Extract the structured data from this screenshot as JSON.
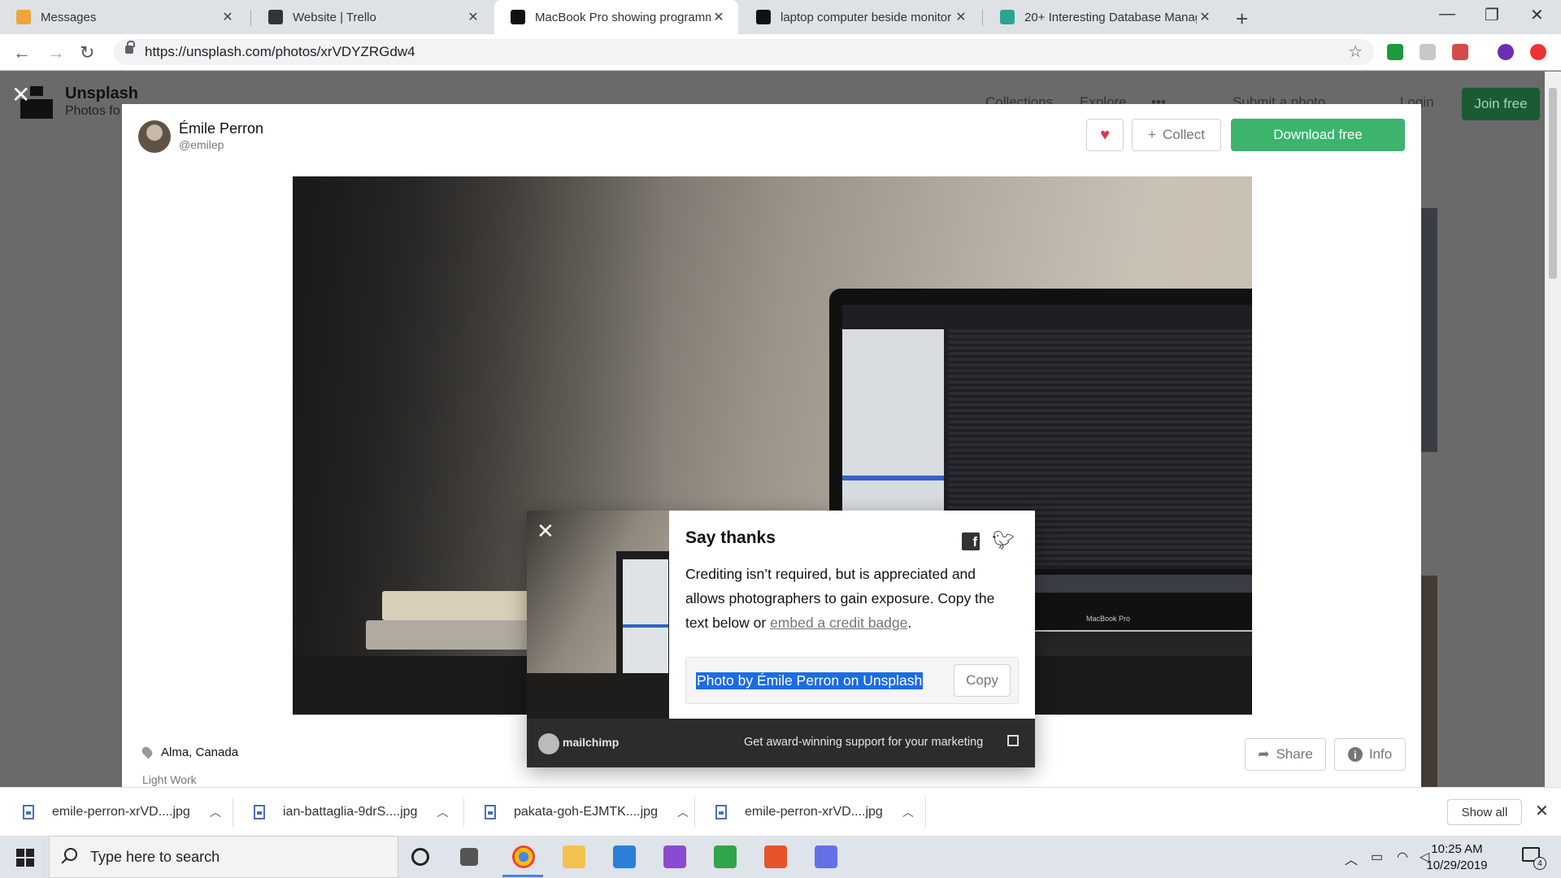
{
  "browser": {
    "tabs": [
      {
        "title": "Messages",
        "favicon_color": "#f3a33c"
      },
      {
        "title": "Website | Trello",
        "favicon_color": "#333333"
      },
      {
        "title": "MacBook Pro showing programm",
        "favicon_color": "#111111",
        "active": true
      },
      {
        "title": "laptop computer beside monitor",
        "favicon_color": "#111111"
      },
      {
        "title": "20+ Interesting Database Manag",
        "favicon_color": "#2ba58e"
      }
    ],
    "new_tab": "+",
    "url": "https://unsplash.com/photos/xrVDYZRGdw4"
  },
  "background_page": {
    "brand": "Unsplash",
    "tagline": "Photos fo",
    "nav": [
      "Collections",
      "Explore",
      "•••",
      "Submit a photo",
      "Login"
    ],
    "join": "Join free"
  },
  "modal": {
    "author_name": "Émile Perron",
    "author_username": "@emilep",
    "collect_label": "Collect",
    "download_label": "Download free",
    "location": "Alma, Canada",
    "series": "Light Work",
    "share_label": "Share",
    "info_label": "Info",
    "macbook_label": "MacBook Pro"
  },
  "thanks": {
    "title": "Say thanks",
    "body_prefix": "Crediting isn’t required, but is appreciated and allows photographers to gain exposure. Copy the text below or ",
    "body_link": "embed a credit badge",
    "body_suffix": ".",
    "credit_text": "Photo by Émile Perron on Unsplash",
    "copy_label": "Copy",
    "sponsor_name": "mailchimp",
    "sponsor_ad": "Get award-winning support for your marketing"
  },
  "downloads": {
    "items": [
      "emile-perron-xrVD....jpg",
      "ian-battaglia-9drS....jpg",
      "pakata-goh-EJMTK....jpg",
      "emile-perron-xrVD....jpg"
    ],
    "show_all": "Show all"
  },
  "taskbar": {
    "search_placeholder": "Type here to search",
    "time": "10:25 AM",
    "date": "10/29/2019",
    "notification_count": "4"
  },
  "colors": {
    "download_green": "#3cb46e",
    "join_green": "#1b5a33",
    "like_red": "#e0334f",
    "selection_blue": "#1c6ce2"
  }
}
